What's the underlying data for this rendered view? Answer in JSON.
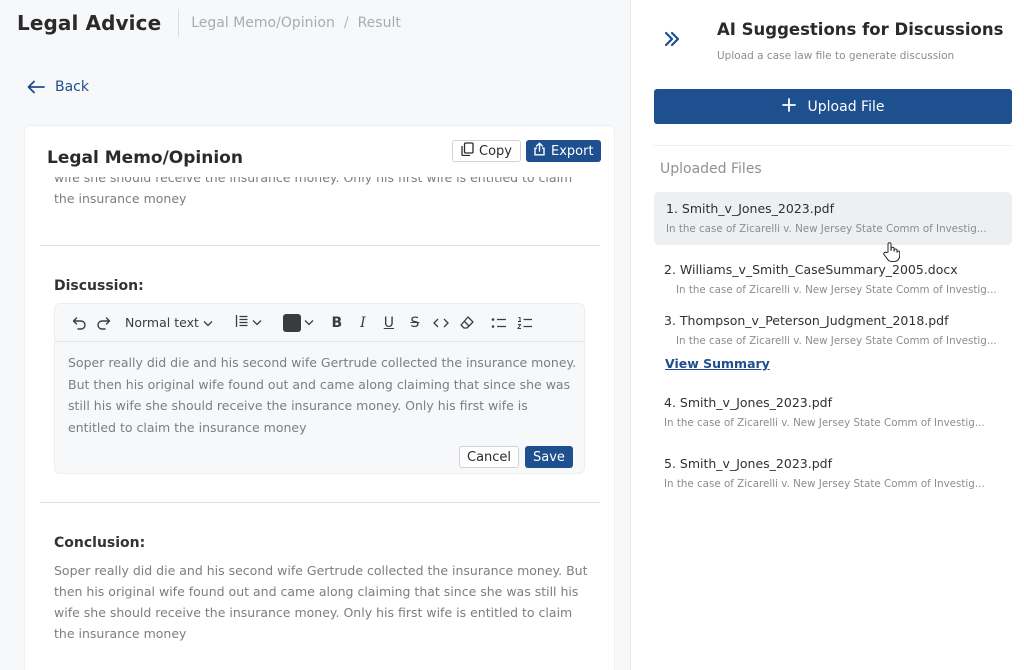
{
  "header": {
    "app_title": "Legal Advice",
    "breadcrumb": [
      "Legal Memo/Opinion",
      "Result"
    ],
    "breadcrumb_sep": "/"
  },
  "back_label": "Back",
  "memo": {
    "title": "Legal Memo/Opinion",
    "copy_label": "Copy",
    "export_label": "Export",
    "top_text": "wife she should receive the insurance money. Only his first wife is entitled to claim the insurance money",
    "discussion_label": "Discussion:",
    "toolbar": {
      "block_type": "Normal text",
      "text_color": "#3a3b3f"
    },
    "discussion_text": "Soper really did die and his second wife Gertrude collected the insurance money. But then his original wife found out and came along claiming that since she was still his wife she should receive the insurance money. Only his first wife is entitled to claim the insurance money",
    "cancel_label": "Cancel",
    "save_label": "Save",
    "conclusion_label": "Conclusion:",
    "conclusion_text": "Soper really did die and his second wife Gertrude collected the insurance money. But then his original wife found out and came along claiming that since she was still his wife she should receive the insurance money. Only his first wife is entitled to claim the insurance money"
  },
  "sidebar": {
    "title": "AI Suggestions for Discussions",
    "subtitle": "Upload a case law file to generate discussion",
    "upload_label": "Upload File",
    "files_heading": "Uploaded Files",
    "view_summary_label": "View Summary",
    "files": [
      {
        "name": "1. Smith_v_Jones_2023.pdf",
        "snippet": "In the case of Zicarelli v. New Jersey State Comm of Investig..."
      },
      {
        "name": "2. Williams_v_Smith_CaseSummary_2005.docx",
        "snippet": "In the case of Zicarelli v. New Jersey State Comm of Investig..."
      },
      {
        "name": "3. Thompson_v_Peterson_Judgment_2018.pdf",
        "snippet": "In the case of Zicarelli v. New Jersey State Comm of Investig..."
      },
      {
        "name": "4. Smith_v_Jones_2023.pdf",
        "snippet": "In the case of Zicarelli v. New Jersey State Comm of Investig..."
      },
      {
        "name": "5. Smith_v_Jones_2023.pdf",
        "snippet": "In the case of Zicarelli v. New Jersey State Comm of Investig..."
      }
    ]
  },
  "colors": {
    "primary": "#1e4f8f",
    "muted_text": "#7b7e85"
  }
}
